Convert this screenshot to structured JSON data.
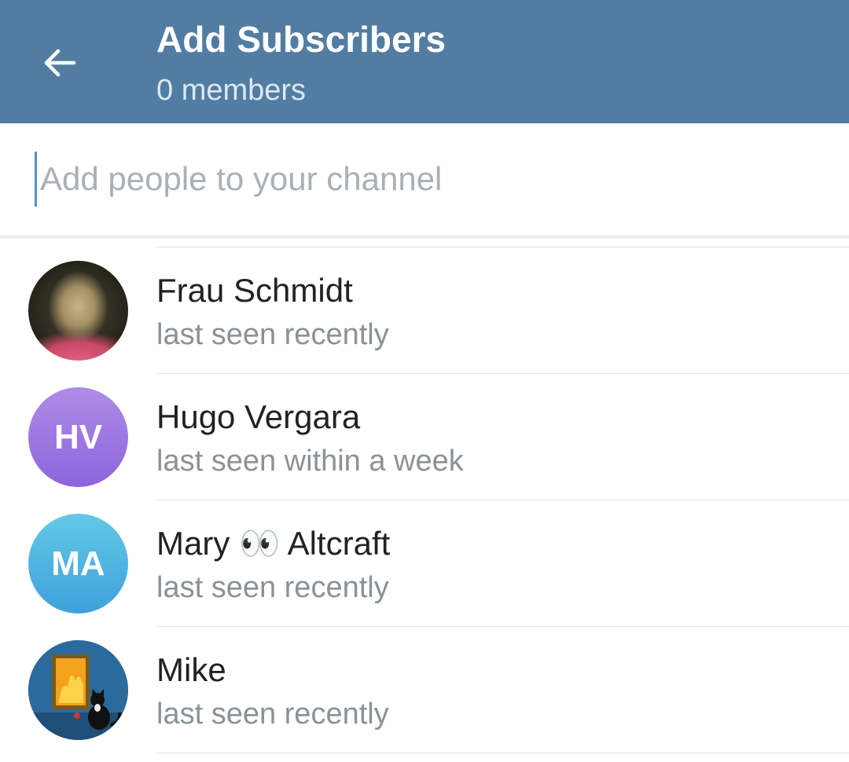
{
  "header": {
    "title": "Add Subscribers",
    "subtitle": "0 members",
    "background_color": "#527da3",
    "back_icon": "arrow-left-icon"
  },
  "search": {
    "value": "",
    "placeholder": "Add people to your channel"
  },
  "contacts": [
    {
      "name": "Frau Schmidt",
      "status": "last seen recently",
      "avatar": {
        "type": "photo"
      }
    },
    {
      "name": "Hugo Vergara",
      "status": "last seen within a week",
      "avatar": {
        "type": "initials",
        "initials": "HV",
        "color": "#9a74e0"
      }
    },
    {
      "name": "Mary 👀 Altcraft",
      "status": "last seen recently",
      "avatar": {
        "type": "initials",
        "initials": "MA",
        "color": "#4fb3e0"
      }
    },
    {
      "name": "Mike",
      "status": "last seen recently",
      "avatar": {
        "type": "photo"
      }
    }
  ]
}
